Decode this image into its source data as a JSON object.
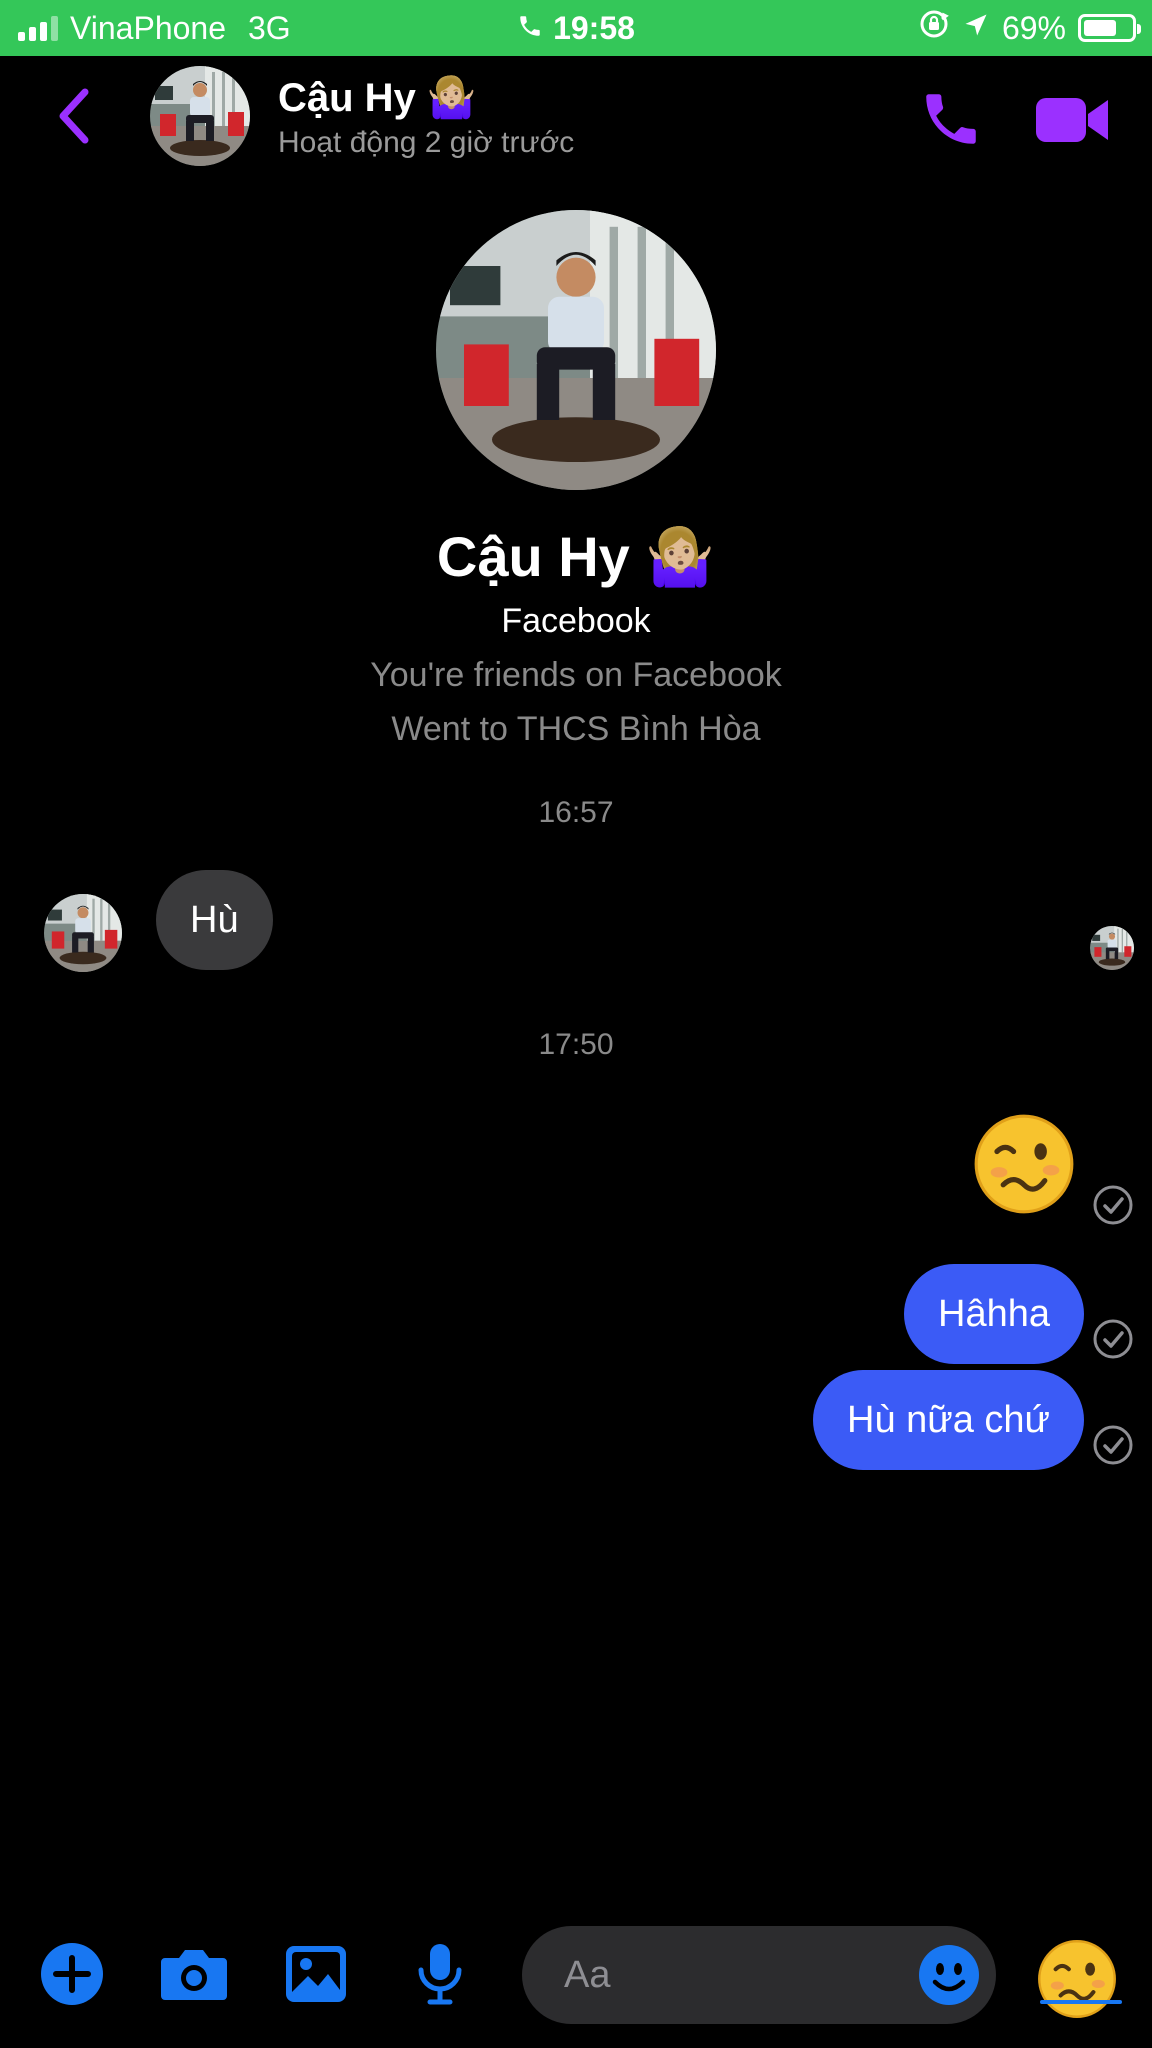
{
  "status_bar": {
    "carrier": "VinaPhone",
    "network": "3G",
    "time": "19:58",
    "battery": "69%",
    "battery_level": 0.69,
    "icons": [
      "signal-icon",
      "phone-call-icon",
      "rotation-lock-icon",
      "location-arrow-icon",
      "battery-icon"
    ]
  },
  "header": {
    "name": "Cậu Hy 🤷🏼‍♀️",
    "status": "Hoạt động 2 giờ trước",
    "icons": [
      "back-icon",
      "phone-icon",
      "video-icon"
    ]
  },
  "profile": {
    "name": "Cậu Hy 🤷🏼‍♀️",
    "subtitle": "Facebook",
    "info": [
      "You're friends on Facebook",
      "Went to THCS Bình Hòa"
    ]
  },
  "conversation": {
    "time_1": "16:57",
    "incoming_1": "Hù",
    "time_2": "17:50",
    "outgoing_emoji": "🥴",
    "outgoing_1": "Hâhha",
    "outgoing_2": "Hù nữa chứ"
  },
  "composer": {
    "placeholder": "Aa",
    "quick_emoji": "🥴",
    "icons": [
      "plus-icon",
      "camera-icon",
      "image-icon",
      "microphone-icon",
      "smiley-icon"
    ]
  },
  "colors": {
    "status_bar": "#34c759",
    "accent_purple": "#9b30ff",
    "outgoing_bubble": "#3b5bf6",
    "incoming_bubble": "#3a3a3c",
    "toolbar_blue": "#1877f2"
  }
}
